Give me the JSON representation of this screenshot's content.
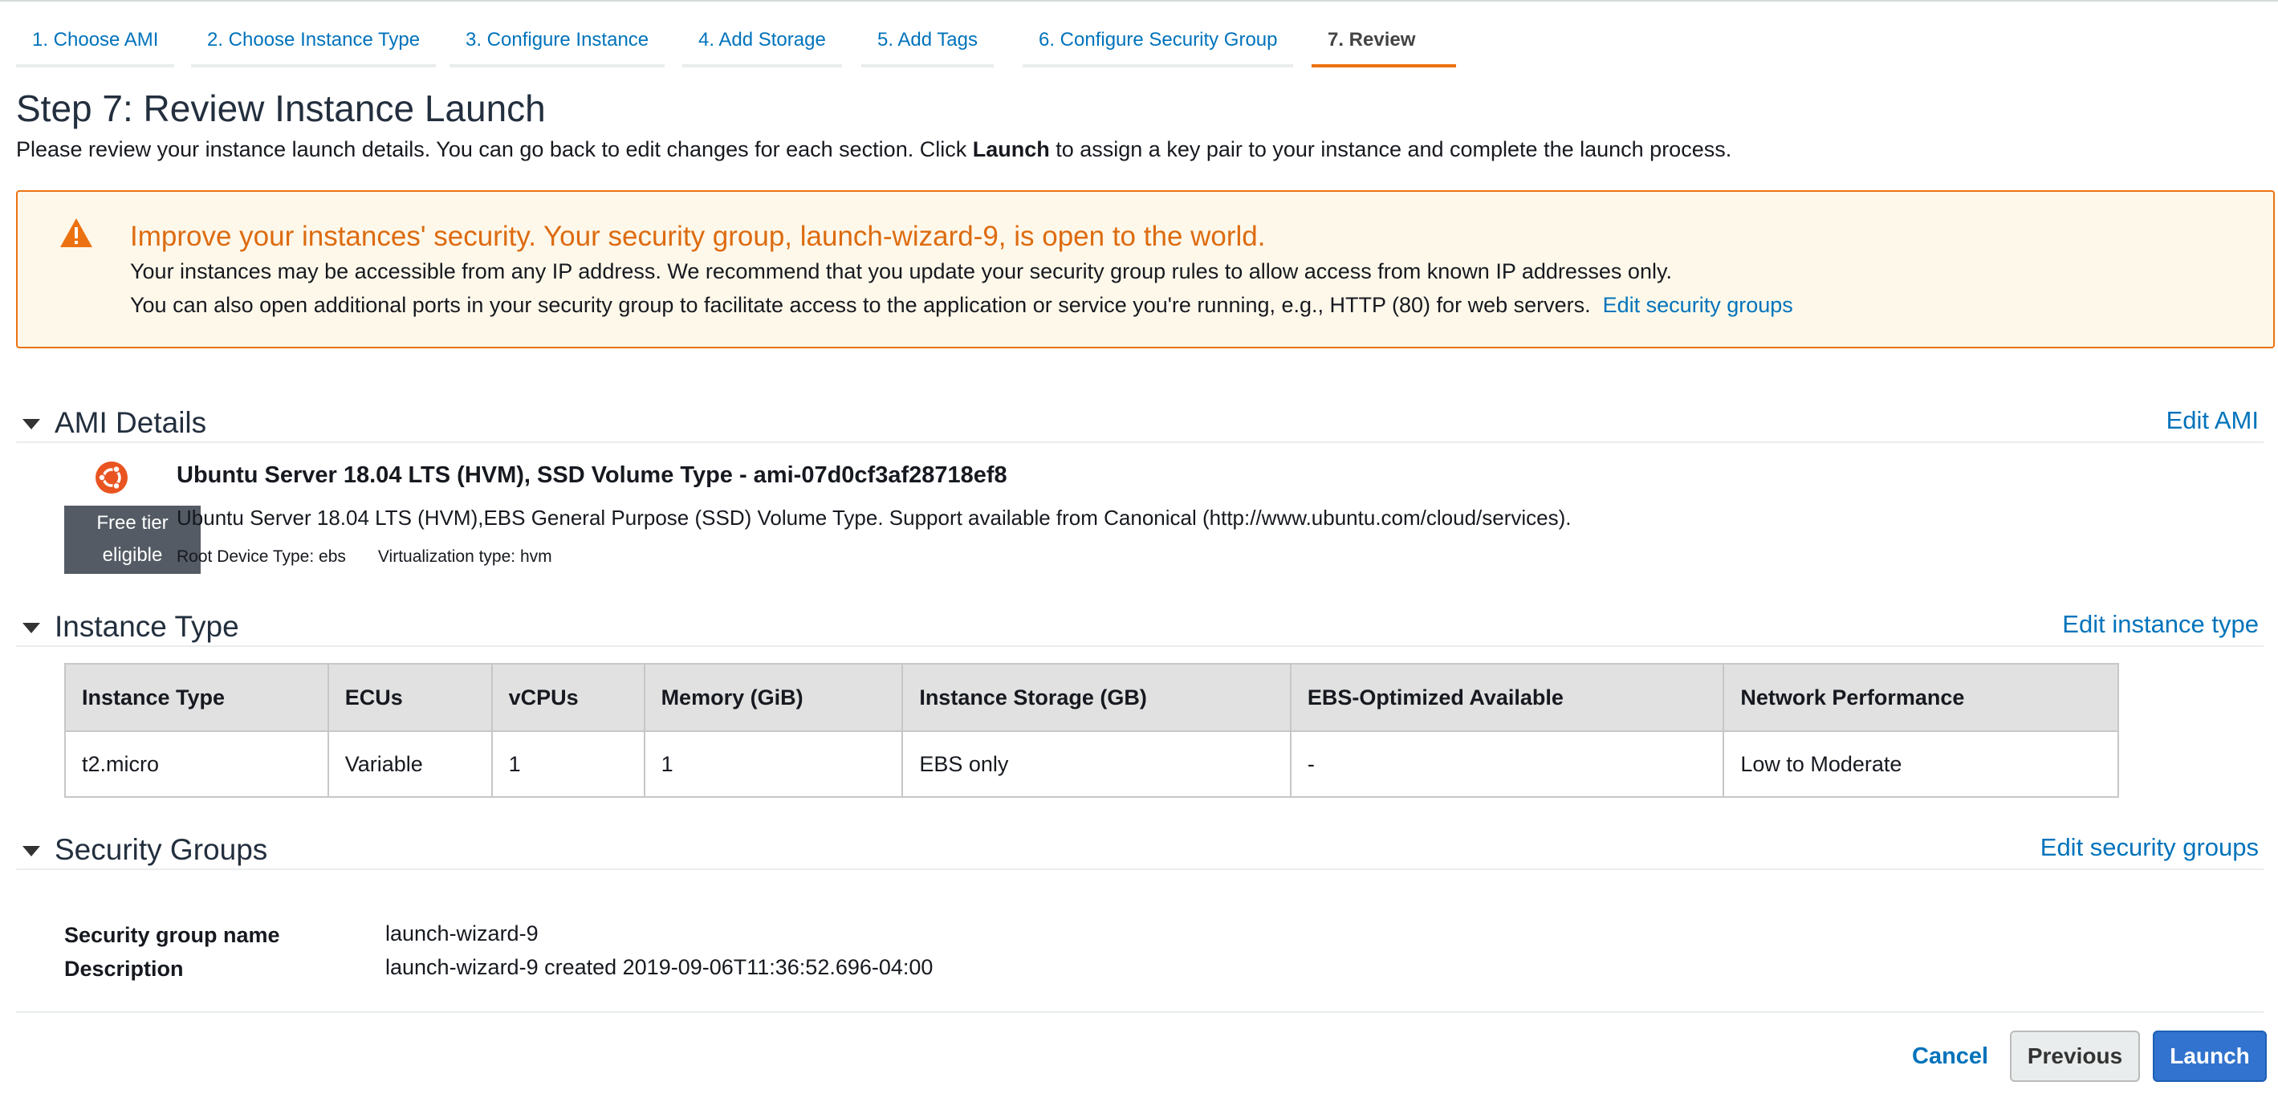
{
  "wizard": {
    "tabs": [
      {
        "label": "1. Choose AMI"
      },
      {
        "label": "2. Choose Instance Type"
      },
      {
        "label": "3. Configure Instance"
      },
      {
        "label": "4. Add Storage"
      },
      {
        "label": "5. Add Tags"
      },
      {
        "label": "6. Configure Security Group"
      },
      {
        "label": "7. Review",
        "active": true
      }
    ]
  },
  "page": {
    "title": "Step 7: Review Instance Launch",
    "intro_before": "Please review your instance launch details. You can go back to edit changes for each section. Click ",
    "intro_bold": "Launch",
    "intro_after": " to assign a key pair to your instance and complete the launch process."
  },
  "warning": {
    "icon": "warning-triangle-icon",
    "title": "Improve your instances' security. Your security group, launch-wizard-9, is open to the world.",
    "line1": "Your instances may be accessible from any IP address. We recommend that you update your security group rules to allow access from known IP addresses only.",
    "line2": "You can also open additional ports in your security group to facilitate access to the application or service you're running, e.g., HTTP (80) for web servers.",
    "link": "Edit security groups",
    "accent_color": "#ec7211"
  },
  "ami": {
    "header": "AMI Details",
    "edit": "Edit AMI",
    "icon": "ubuntu-icon",
    "badge_line1": "Free tier",
    "badge_line2": "eligible",
    "title": "Ubuntu Server 18.04 LTS (HVM), SSD Volume Type - ami-07d0cf3af28718ef8",
    "description": "Ubuntu Server 18.04 LTS (HVM),EBS General Purpose (SSD) Volume Type. Support available from Canonical (http://www.ubuntu.com/cloud/services).",
    "root_device": "Root Device Type: ebs",
    "virtualization": "Virtualization type: hvm"
  },
  "instance": {
    "header": "Instance Type",
    "edit": "Edit instance type",
    "columns": [
      "Instance Type",
      "ECUs",
      "vCPUs",
      "Memory (GiB)",
      "Instance Storage (GB)",
      "EBS-Optimized Available",
      "Network Performance"
    ],
    "row": [
      "t2.micro",
      "Variable",
      "1",
      "1",
      "EBS only",
      "-",
      "Low to Moderate"
    ]
  },
  "security": {
    "header": "Security Groups",
    "edit": "Edit security groups",
    "name_label": "Security group name",
    "name_value": "launch-wizard-9",
    "desc_label": "Description",
    "desc_value": "launch-wizard-9 created 2019-09-06T11:36:52.696-04:00"
  },
  "footer": {
    "cancel": "Cancel",
    "previous": "Previous",
    "launch": "Launch",
    "primary_color": "#3173ce"
  }
}
